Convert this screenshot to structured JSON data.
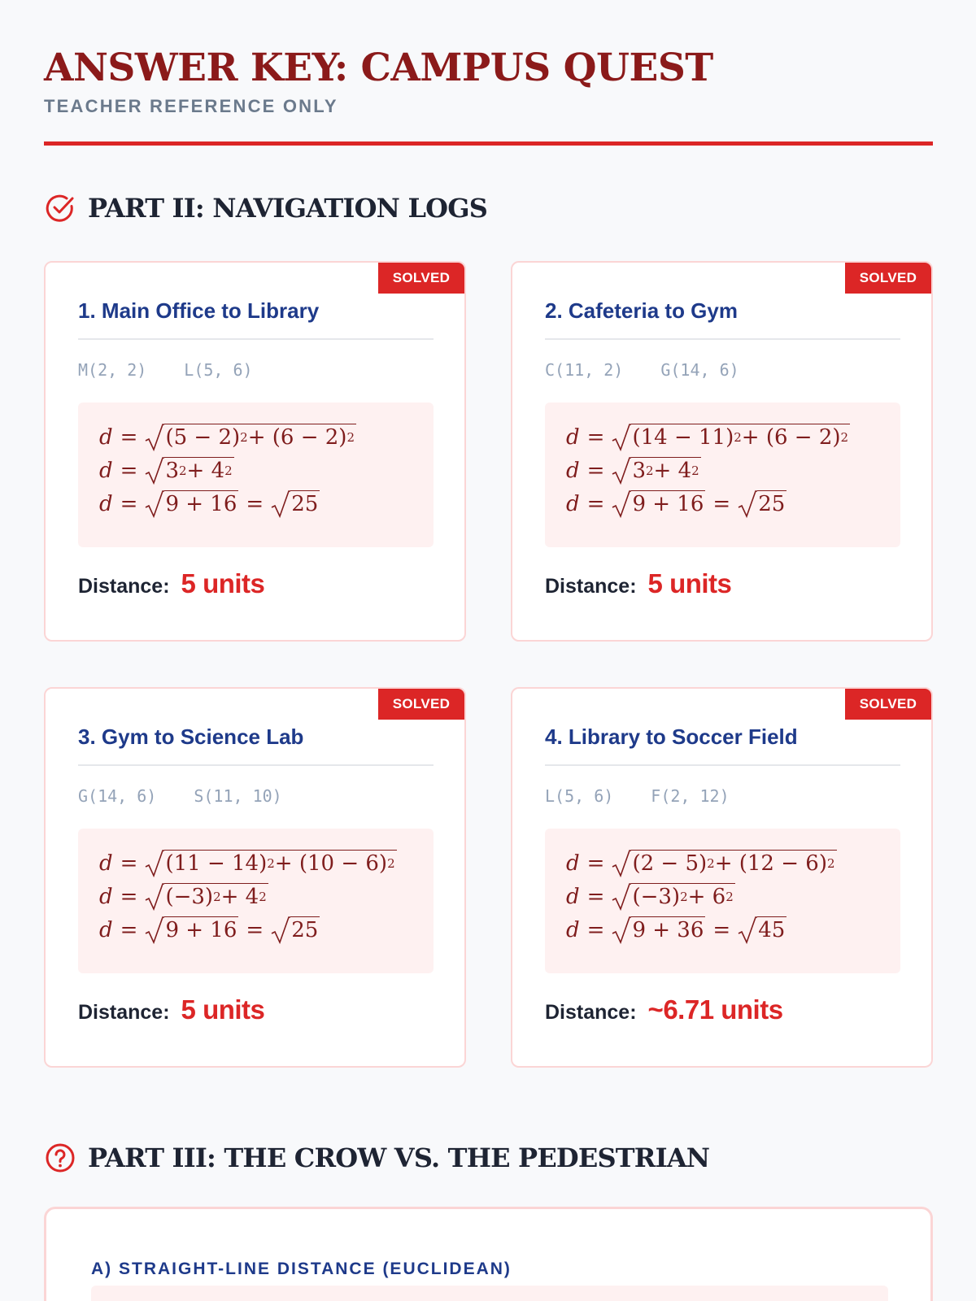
{
  "header": {
    "title": "ANSWER KEY: CAMPUS QUEST",
    "subtitle": "TEACHER REFERENCE ONLY"
  },
  "colors": {
    "accent": "#dc2626",
    "title": "#8b1a1a",
    "heading_blue": "#1e3a8a",
    "math": "#7f1d1d",
    "mathbox_bg": "#fef1f1",
    "border": "#fbd5d5"
  },
  "sections": {
    "part2": {
      "label": "PART II: NAVIGATION LOGS",
      "icon": "check-circle-icon"
    },
    "part3": {
      "label": "PART III: THE CROW VS. THE PEDESTRIAN",
      "icon": "question-circle-icon"
    }
  },
  "cards": [
    {
      "badge": "SOLVED",
      "title": "1. Main Office to Library",
      "points": [
        "M(2, 2)",
        "L(5, 6)"
      ],
      "lines": [
        {
          "rad": [
            {
              "t": "(5 − 2)"
            },
            {
              "s": "2"
            },
            {
              "t": " + (6 − 2)"
            },
            {
              "s": "2"
            }
          ]
        },
        {
          "rad": [
            {
              "t": "3"
            },
            {
              "s": "2"
            },
            {
              "t": " + 4"
            },
            {
              "s": "2"
            }
          ]
        },
        {
          "rad": [
            {
              "t": "9 + 16"
            }
          ],
          "eq": [
            {
              "t": "25"
            }
          ]
        }
      ],
      "distance_label": "Distance:",
      "distance_value": "5 units"
    },
    {
      "badge": "SOLVED",
      "title": "2. Cafeteria to Gym",
      "points": [
        "C(11, 2)",
        "G(14, 6)"
      ],
      "lines": [
        {
          "rad": [
            {
              "t": "(14 − 11)"
            },
            {
              "s": "2"
            },
            {
              "t": " + (6 − 2)"
            },
            {
              "s": "2"
            }
          ]
        },
        {
          "rad": [
            {
              "t": "3"
            },
            {
              "s": "2"
            },
            {
              "t": " + 4"
            },
            {
              "s": "2"
            }
          ]
        },
        {
          "rad": [
            {
              "t": "9 + 16"
            }
          ],
          "eq": [
            {
              "t": "25"
            }
          ]
        }
      ],
      "distance_label": "Distance:",
      "distance_value": "5 units"
    },
    {
      "badge": "SOLVED",
      "title": "3. Gym to Science Lab",
      "points": [
        "G(14, 6)",
        "S(11, 10)"
      ],
      "lines": [
        {
          "rad": [
            {
              "t": "(11 − 14)"
            },
            {
              "s": "2"
            },
            {
              "t": " + (10 − 6)"
            },
            {
              "s": "2"
            }
          ]
        },
        {
          "rad": [
            {
              "t": "(−3)"
            },
            {
              "s": "2"
            },
            {
              "t": " + 4"
            },
            {
              "s": "2"
            }
          ]
        },
        {
          "rad": [
            {
              "t": "9 + 16"
            }
          ],
          "eq": [
            {
              "t": "25"
            }
          ]
        }
      ],
      "distance_label": "Distance:",
      "distance_value": "5 units"
    },
    {
      "badge": "SOLVED",
      "title": "4. Library to Soccer Field",
      "points": [
        "L(5, 6)",
        "F(2, 12)"
      ],
      "lines": [
        {
          "rad": [
            {
              "t": "(2 − 5)"
            },
            {
              "s": "2"
            },
            {
              "t": " + (12 − 6)"
            },
            {
              "s": "2"
            }
          ]
        },
        {
          "rad": [
            {
              "t": "(−3)"
            },
            {
              "s": "2"
            },
            {
              "t": " + 6"
            },
            {
              "s": "2"
            }
          ]
        },
        {
          "rad": [
            {
              "t": "9 + 36"
            }
          ],
          "eq": [
            {
              "t": "45"
            }
          ]
        }
      ],
      "distance_label": "Distance:",
      "distance_value": "~6.71 units"
    }
  ],
  "part3": {
    "subheading": "A) STRAIGHT-LINE DISTANCE (EUCLIDEAN)"
  }
}
